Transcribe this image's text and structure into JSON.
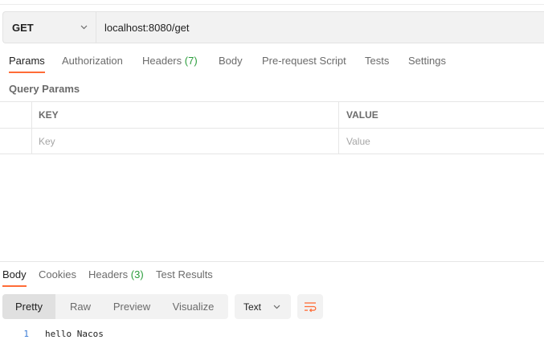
{
  "request": {
    "method": "GET",
    "url": "localhost:8080/get"
  },
  "request_tabs": [
    {
      "label": "Params",
      "active": true
    },
    {
      "label": "Authorization"
    },
    {
      "label": "Headers",
      "count": "(7)"
    },
    {
      "label": "Body"
    },
    {
      "label": "Pre-request Script"
    },
    {
      "label": "Tests"
    },
    {
      "label": "Settings"
    }
  ],
  "query_params": {
    "title": "Query Params",
    "headers": {
      "key": "KEY",
      "value": "VALUE"
    },
    "placeholders": {
      "key": "Key",
      "value": "Value"
    }
  },
  "response_tabs": [
    {
      "label": "Body",
      "active": true
    },
    {
      "label": "Cookies"
    },
    {
      "label": "Headers",
      "count": "(3)"
    },
    {
      "label": "Test Results"
    }
  ],
  "view_modes": [
    "Pretty",
    "Raw",
    "Preview",
    "Visualize"
  ],
  "active_view": "Pretty",
  "format": "Text",
  "wrap_icon": "wrap-lines-icon",
  "response_body": [
    {
      "line": "1",
      "text": "hello Nacos"
    }
  ],
  "colors": {
    "accent": "#ff6c37",
    "count": "#2a9d3b",
    "line_number": "#3a7bd5"
  }
}
